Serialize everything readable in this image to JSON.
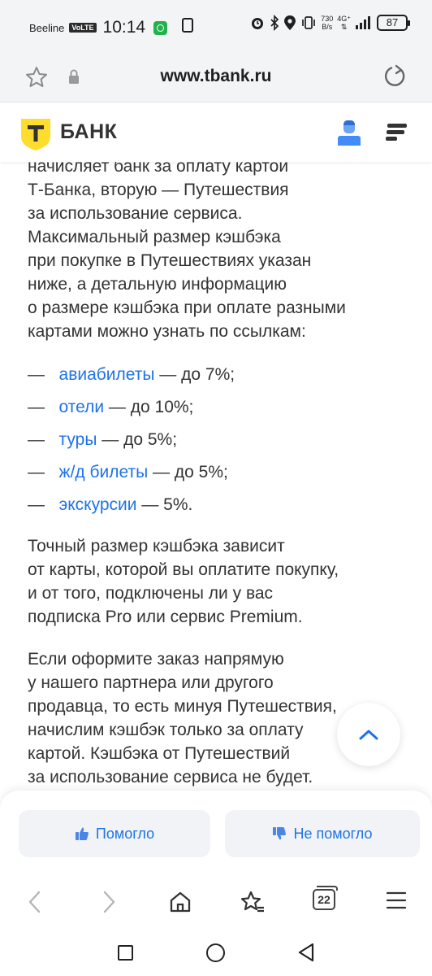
{
  "status_bar": {
    "carrier": "Beeline",
    "volte": "VoLTE",
    "time": "10:14",
    "speed_value": "730",
    "speed_unit": "B/s",
    "network": "4G⁺",
    "battery": "87"
  },
  "browser": {
    "url": "www.tbank.ru",
    "tabs_count": "22"
  },
  "site_header": {
    "logo_letter": "Т",
    "logo_text": "БАНК",
    "logo_color": "#ffdd2d"
  },
  "article": {
    "paragraph_top_lines": [
      "начисляет банк за оплату картой",
      "Т-Банка, вторую — Путешествия",
      "за использование сервиса.",
      "Максимальный размер кэшбэка",
      "при покупке в Путешествиях указан",
      "ниже, а детальную информацию",
      "о размере кэшбэка при оплате разными",
      "картами можно узнать по ссылкам:"
    ],
    "bullets": [
      {
        "dash": "—",
        "link": "авиабилеты",
        "rest": " — до 7%;"
      },
      {
        "dash": "—",
        "link": "отели",
        "rest": " — до 10%;"
      },
      {
        "dash": "—",
        "link": "туры",
        "rest": " — до 5%;"
      },
      {
        "dash": "—",
        "link": "ж/д билеты",
        "rest": " — до 5%;"
      },
      {
        "dash": "—",
        "link": "экскурсии",
        "rest": " — 5%."
      }
    ],
    "paragraph_2_lines": [
      "Точный размер кэшбэка зависит",
      "от карты, которой вы оплатите покупку,",
      "и от того, подключены ли у вас",
      "подписка Pro или сервис Premium."
    ],
    "paragraph_3_lines": [
      "Если оформите заказ напрямую",
      "у нашего партнера или другого",
      "продавца, то есть минуя Путешествия,",
      "начислим кэшбэк только за оплату",
      "картой. Кэшбэка от Путешествий",
      "за использование сервиса не будет."
    ],
    "link_color": "#1e73e8"
  },
  "feedback": {
    "helped_label": "Помогло",
    "not_helped_label": "Не помогло"
  },
  "icons": {
    "favorite": "star-icon",
    "lock": "lock-icon",
    "reload": "reload-icon",
    "profile": "profile-icon",
    "menu": "menu-icon",
    "scroll_top": "chevron-up-icon",
    "thumb_up": "thumb-up-icon",
    "thumb_down": "thumb-down-icon",
    "back": "back-icon",
    "forward": "forward-icon",
    "home": "home-icon",
    "bookmarks": "bookmark-star-icon",
    "tabs": "tabs-icon",
    "browser_menu": "hamburger-icon"
  }
}
